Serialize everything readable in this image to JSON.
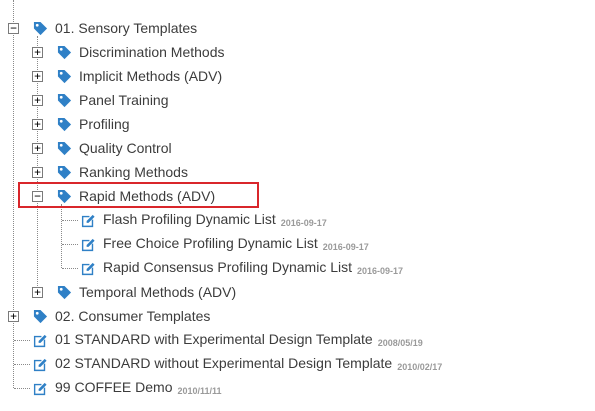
{
  "tree": {
    "root_sensory": {
      "label": "01. Sensory Templates",
      "toggle": "−"
    },
    "sensory_children": [
      {
        "label": "Discrimination Methods",
        "toggle": "+"
      },
      {
        "label": "Implicit Methods (ADV)",
        "toggle": "+"
      },
      {
        "label": "Panel Training",
        "toggle": "+"
      },
      {
        "label": "Profiling",
        "toggle": "+"
      },
      {
        "label": "Quality Control",
        "toggle": "+"
      },
      {
        "label": "Ranking Methods",
        "toggle": "+"
      },
      {
        "label": "Rapid Methods (ADV)",
        "toggle": "−"
      },
      {
        "label": "Temporal Methods (ADV)",
        "toggle": "+"
      }
    ],
    "rapid_children": [
      {
        "label": "Flash Profiling Dynamic List",
        "date": "2016-09-17"
      },
      {
        "label": "Free Choice Profiling Dynamic List",
        "date": "2016-09-17"
      },
      {
        "label": "Rapid Consensus Profiling Dynamic List",
        "date": "2016-09-17"
      }
    ],
    "root_consumer": {
      "label": "02. Consumer Templates",
      "toggle": "+"
    },
    "root_items": [
      {
        "label": "01 STANDARD with Experimental Design Template",
        "date": "2008/05/19"
      },
      {
        "label": "02 STANDARD without Experimental Design Template",
        "date": "2010/02/17"
      },
      {
        "label": "99 COFFEE Demo",
        "date": "2010/11/11"
      }
    ]
  },
  "colors": {
    "icon_blue": "#2f80c6",
    "highlight_red": "#d9262b",
    "text": "#3c3c3c",
    "date": "#9a9a9a"
  },
  "icons": {
    "folder": "tag-icon",
    "item": "edit-icon"
  }
}
